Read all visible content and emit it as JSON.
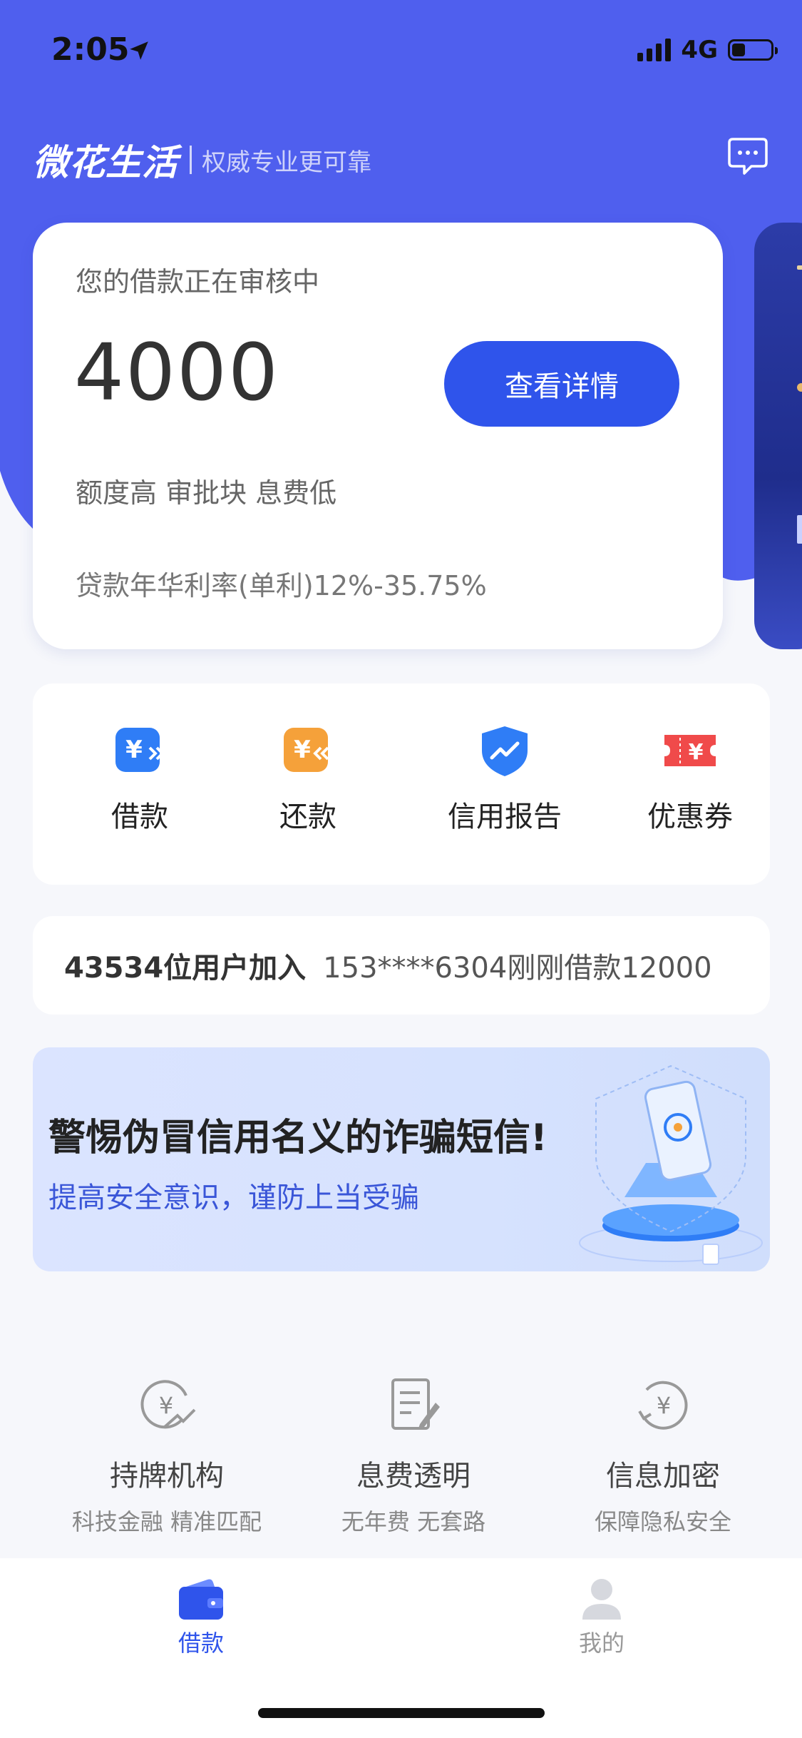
{
  "status_bar": {
    "time": "2:05",
    "network": "4G"
  },
  "header": {
    "brand": "微花生活",
    "slogan": "权威专业更可靠",
    "message_icon": "chat-bubble-icon"
  },
  "loan_card": {
    "status": "您的借款正在审核中",
    "amount": "4000",
    "detail_button": "查看详情",
    "tags": "额度高 审批块 息费低",
    "rate": "贷款年华利率(单利)12%-35.75%"
  },
  "actions": [
    {
      "label": "借款",
      "icon": "yuan-forward-icon"
    },
    {
      "label": "还款",
      "icon": "yuan-back-icon"
    },
    {
      "label": "信用报告",
      "icon": "shield-chart-icon"
    },
    {
      "label": "优惠券",
      "icon": "coupon-ticket-icon"
    }
  ],
  "ticker": {
    "count": "43534位用户加入",
    "message": "153****6304刚刚借款12000"
  },
  "banner": {
    "title": "警惕伪冒信用名义的诈骗短信!",
    "subtitle": "提高安全意识，谨防上当受骗"
  },
  "features": [
    {
      "title": "持牌机构",
      "subtitle": "科技金融 精准匹配",
      "icon": "licensed-yuan-icon"
    },
    {
      "title": "息费透明",
      "subtitle": "无年费 无套路",
      "icon": "document-edit-icon"
    },
    {
      "title": "信息加密",
      "subtitle": "保障隐私安全",
      "icon": "encrypt-yuan-icon"
    }
  ],
  "tabbar": {
    "items": [
      {
        "label": "借款",
        "icon": "wallet-icon",
        "active": true
      },
      {
        "label": "我的",
        "icon": "user-icon",
        "active": false
      }
    ]
  },
  "colors": {
    "primary": "#2f54eb",
    "hero": "#4f5fee",
    "background": "#f6f7fb"
  }
}
